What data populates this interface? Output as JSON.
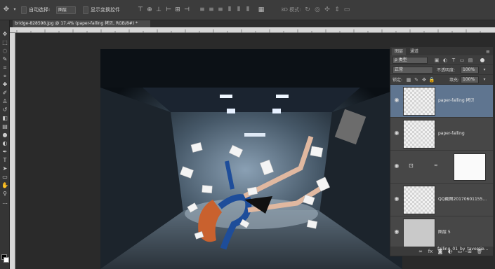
{
  "options_bar": {
    "auto_select_label": "自动选择:",
    "auto_select_value": "图层",
    "show_transform_label": "显示变换控件",
    "mode_3d_label": "3D 模式:"
  },
  "document": {
    "tab_title": "bridge-828598.jpg @ 17.4% (paper-falling 拷贝, RGB/8#) *"
  },
  "layers_panel": {
    "tabs": [
      "图层",
      "通道"
    ],
    "filter_kind": "ρ 类型",
    "blend_mode": "正常",
    "opacity_label": "不透明度:",
    "opacity_value": "100%",
    "lock_label": "锁定:",
    "fill_label": "填充:",
    "fill_value": "100%",
    "layers": [
      {
        "name": "paper-falling 拷贝",
        "selected": true
      },
      {
        "name": "paper-falling",
        "selected": false
      },
      {
        "name": "",
        "selected": false
      },
      {
        "name": "QQ截图20170601155...",
        "selected": false
      },
      {
        "name": "图层 5",
        "selected": false
      },
      {
        "name": "falling_01_by_taversie...",
        "selected": false
      }
    ],
    "footer_icons": [
      "link-icon",
      "fx-icon",
      "mask-icon",
      "adjustment-icon",
      "folder-icon",
      "new-layer-icon",
      "trash-icon"
    ]
  },
  "icons": {
    "move_tool": "move-icon",
    "eye": "eye-icon"
  },
  "colors": {
    "selected_layer": "#5f7590",
    "panel_bg": "#474747",
    "app_bg": "#2b2b2b"
  }
}
